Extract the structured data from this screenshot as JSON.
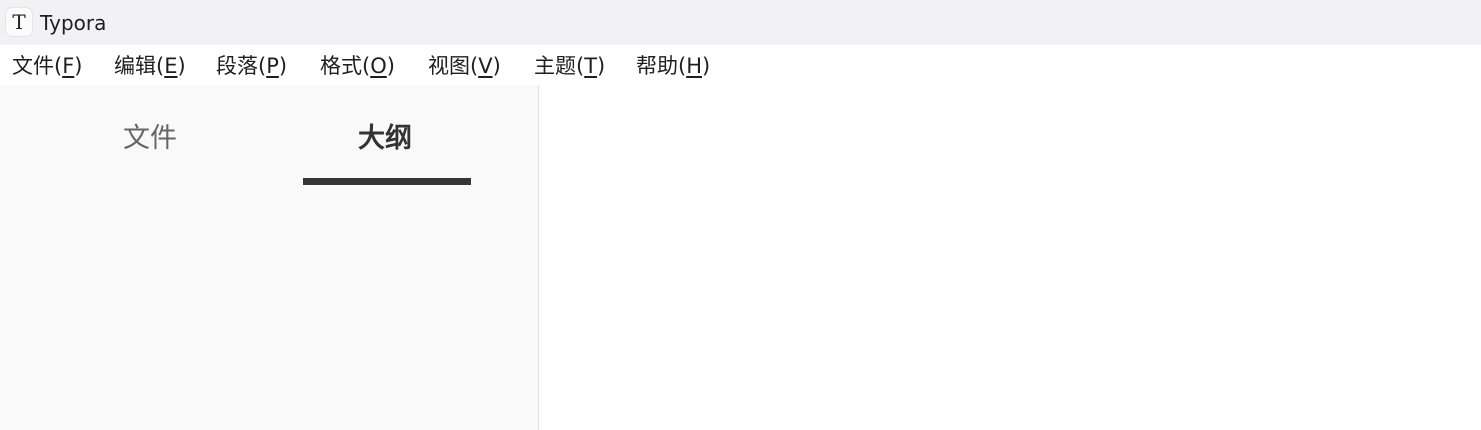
{
  "window": {
    "app_icon_glyph": "T",
    "title": "Typora"
  },
  "menu": [
    {
      "label": "文件(",
      "mnemonic": "F",
      "close": ")"
    },
    {
      "label": "编辑(",
      "mnemonic": "E",
      "close": ")"
    },
    {
      "label": "段落(",
      "mnemonic": "P",
      "close": ")"
    },
    {
      "label": "格式(",
      "mnemonic": "O",
      "close": ")"
    },
    {
      "label": "视图(",
      "mnemonic": "V",
      "close": ")"
    },
    {
      "label": "主题(",
      "mnemonic": "T",
      "close": ")"
    },
    {
      "label": "帮助(",
      "mnemonic": "H",
      "close": ")"
    }
  ],
  "sidebar": {
    "tabs": [
      {
        "label": "文件",
        "active": false
      },
      {
        "label": "大纲",
        "active": true
      }
    ]
  },
  "colors": {
    "titlebar_bg": "#f2f2f4",
    "sidebar_bg": "#f9f9f9",
    "tab_indicator": "#363636"
  }
}
